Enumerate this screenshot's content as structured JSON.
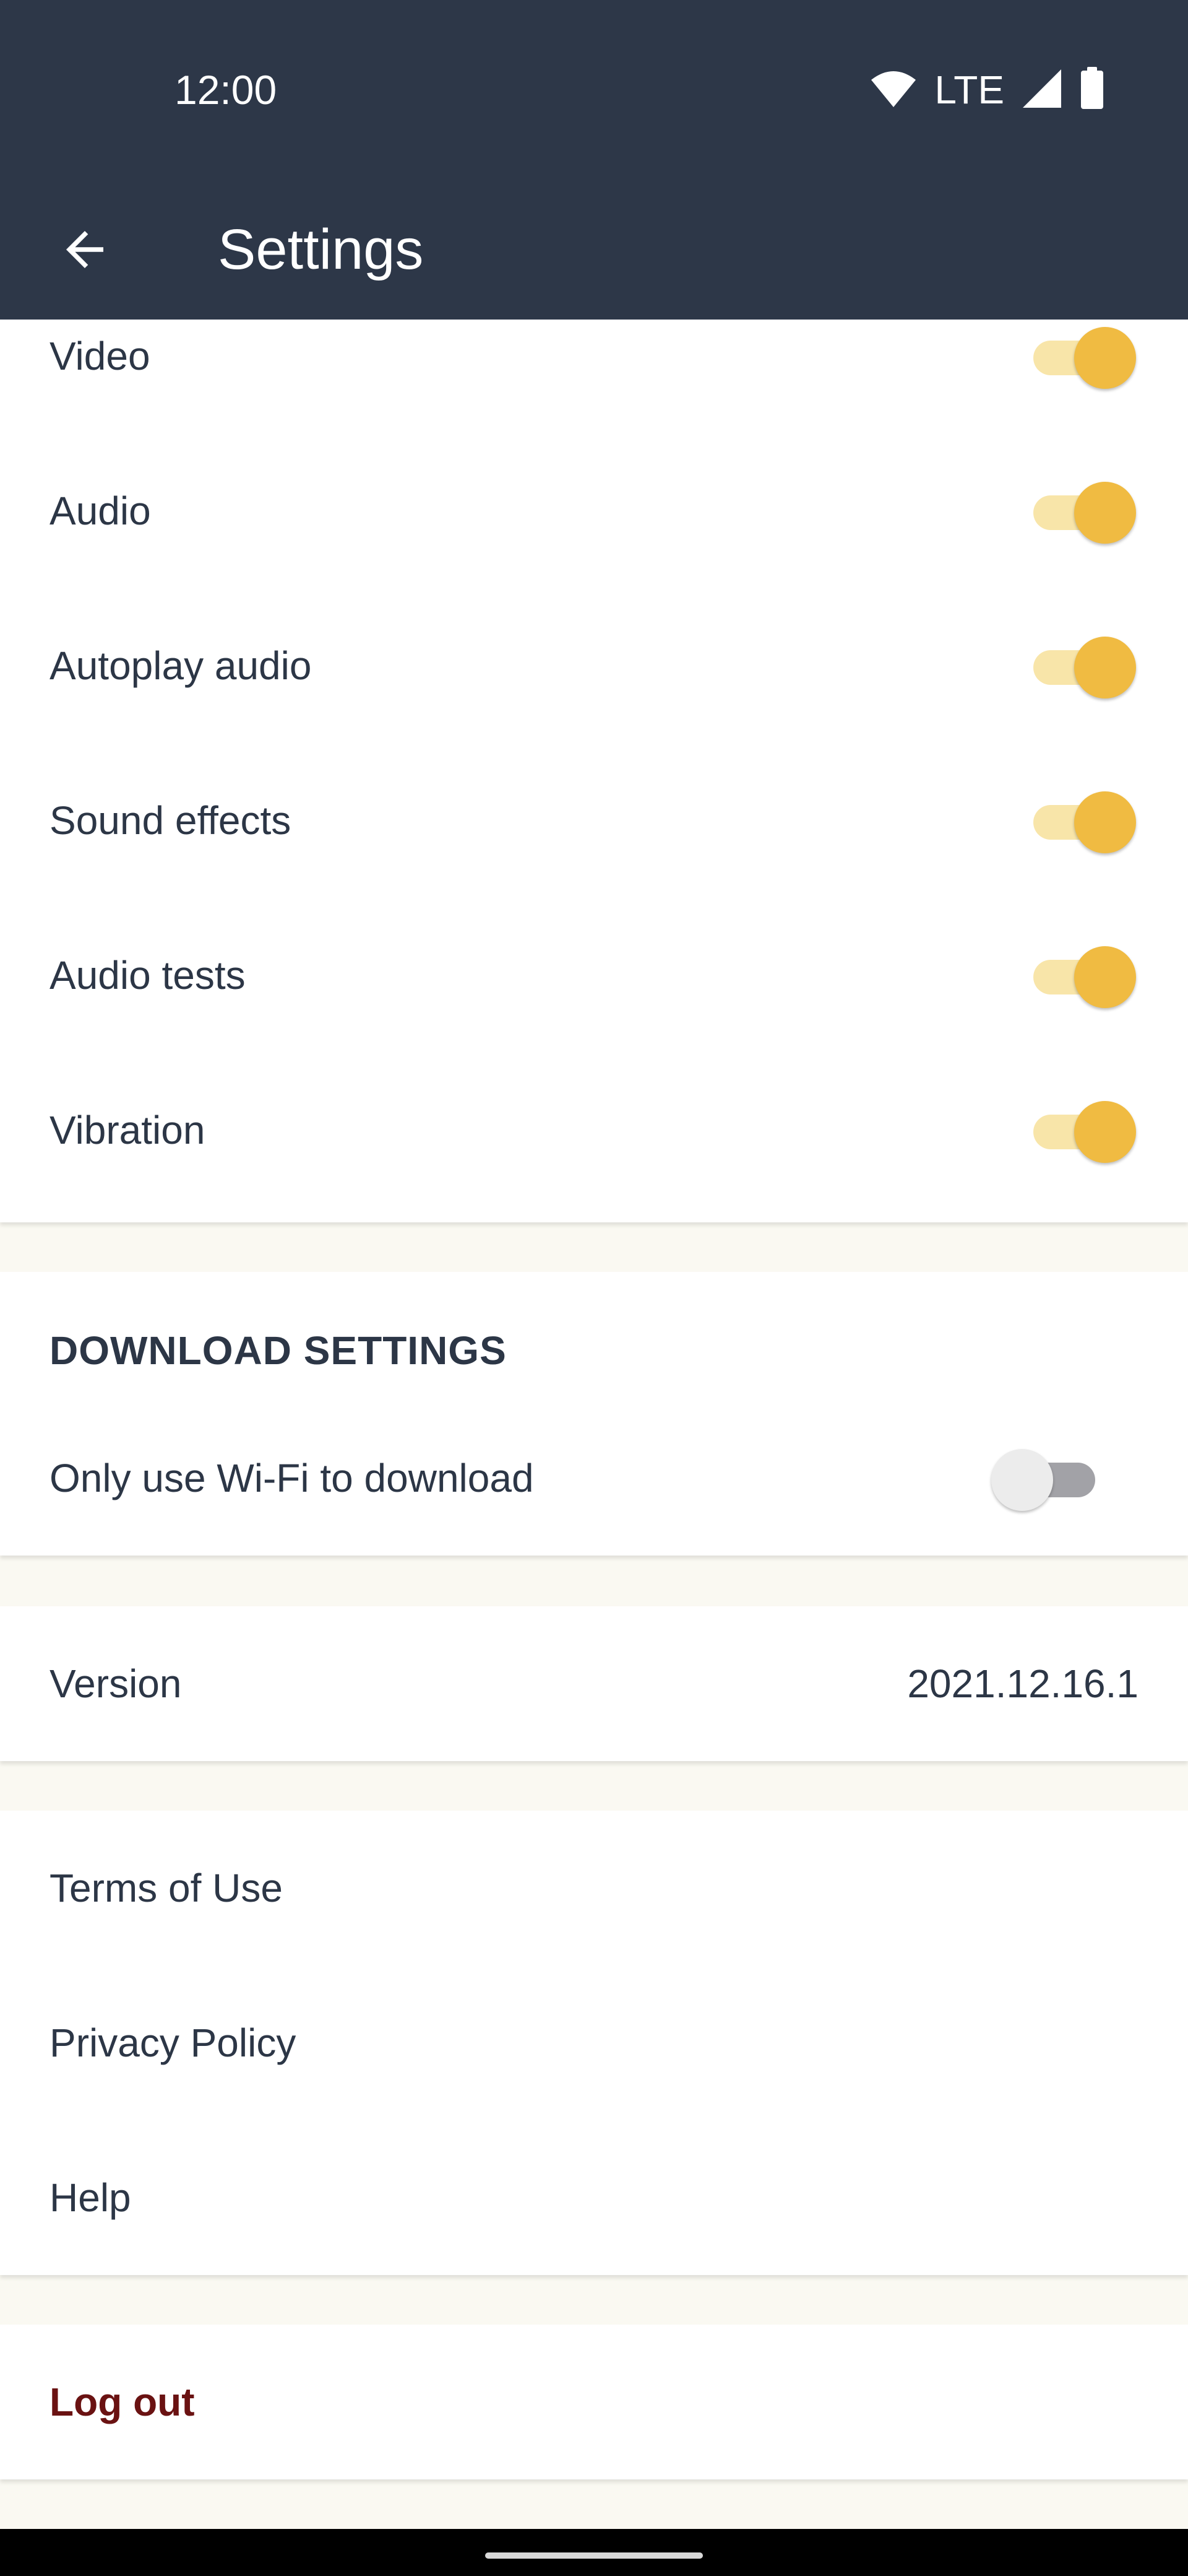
{
  "status_bar": {
    "time": "12:00",
    "network": "LTE",
    "icons": [
      "wifi-icon",
      "cellular-signal-icon",
      "battery-icon"
    ]
  },
  "app_bar": {
    "title": "Settings",
    "back_icon": "arrow-back-icon"
  },
  "media_settings": [
    {
      "label": "Video",
      "enabled": true
    },
    {
      "label": "Audio",
      "enabled": true
    },
    {
      "label": "Autoplay audio",
      "enabled": true
    },
    {
      "label": "Sound effects",
      "enabled": true
    },
    {
      "label": "Audio tests",
      "enabled": true
    },
    {
      "label": "Vibration",
      "enabled": true
    }
  ],
  "download_settings": {
    "header": "DOWNLOAD SETTINGS",
    "wifi_only": {
      "label": "Only use Wi-Fi to download",
      "enabled": false
    }
  },
  "version": {
    "label": "Version",
    "value": "2021.12.16.1"
  },
  "links": [
    {
      "label": "Terms of Use"
    },
    {
      "label": "Privacy Policy"
    },
    {
      "label": "Help"
    }
  ],
  "logout": {
    "label": "Log out"
  },
  "colors": {
    "app_bar": "#2d3748",
    "toggle_on_thumb": "#f0bb42",
    "toggle_on_track": "#f8e5a9",
    "toggle_off_thumb": "#ececec",
    "toggle_off_track": "#a2a2a7",
    "logout_text": "#6a1212",
    "page_background": "#faf9f2"
  }
}
